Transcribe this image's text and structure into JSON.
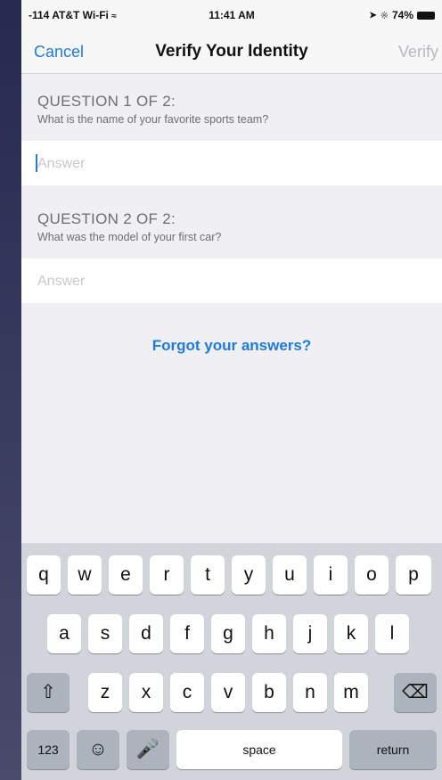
{
  "status_bar": {
    "carrier": "-114 AT&T Wi-Fi",
    "time": "11:41 AM",
    "battery": "74%"
  },
  "nav": {
    "cancel": "Cancel",
    "title": "Verify Your Identity",
    "verify": "Verify"
  },
  "questions": [
    {
      "title": "QUESTION 1 OF 2:",
      "text": "What is the name of your favorite sports team?",
      "placeholder": "Answer"
    },
    {
      "title": "QUESTION 2 OF 2:",
      "text": "What was the model of your first car?",
      "placeholder": "Answer"
    }
  ],
  "forgot_link": "Forgot your answers?",
  "keyboard": {
    "row1": [
      "q",
      "w",
      "e",
      "r",
      "t",
      "y",
      "u",
      "i",
      "o",
      "p"
    ],
    "row2": [
      "a",
      "s",
      "d",
      "f",
      "g",
      "h",
      "j",
      "k",
      "l"
    ],
    "row3": [
      "z",
      "x",
      "c",
      "v",
      "b",
      "n",
      "m"
    ],
    "numbers": "123",
    "space": "space",
    "return": "return",
    "shift_icon": "shift-icon",
    "delete_icon": "delete-icon",
    "emoji_icon": "emoji-icon",
    "mic_icon": "microphone-icon"
  },
  "colors": {
    "accent": "#1f7ae0",
    "disabled": "#b8b8c0"
  }
}
